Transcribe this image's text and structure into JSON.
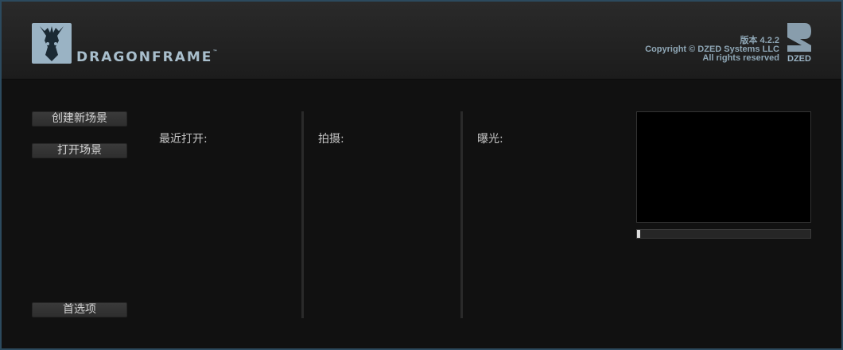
{
  "header": {
    "brand": "DRAGONFRAME",
    "trademark": "™",
    "version": "版本 4.2.2",
    "copyright": "Copyright © DZED Systems LLC",
    "rights": "All rights reserved",
    "company_logo_text": "DZED",
    "logo_icon": "dragon-head-icon"
  },
  "actions": {
    "new_scene": "创建新场景",
    "open_scene": "打开场景",
    "preferences": "首选项"
  },
  "columns": {
    "recent": "最近打开:",
    "shoot": "拍摄:",
    "exposure": "曝光:"
  },
  "preview": {
    "progress": 0.02
  },
  "colors": {
    "accent": "#9ab3c4",
    "background": "#111111",
    "header": "#242424"
  }
}
